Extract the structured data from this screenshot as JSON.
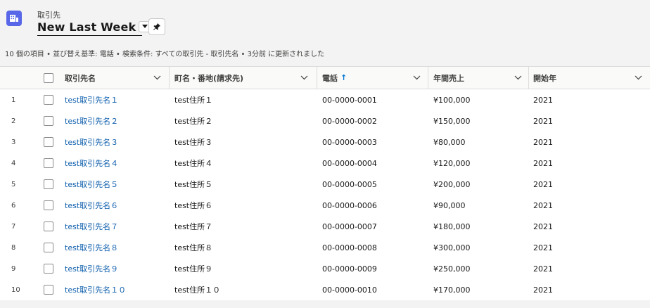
{
  "header": {
    "object_label": "取引先",
    "title": "New Last Week",
    "icon": "account-grid-icon",
    "dropdown_icon": "chevron-down-icon",
    "pin_icon": "pin-icon",
    "summary": "10 個の項目 • 並び替え基準: 電話 • 検索条件: すべての取引先 - 取引先名 • 3分前 に更新されました"
  },
  "columns": [
    {
      "key": "name",
      "label": "取引先名"
    },
    {
      "key": "address",
      "label": "町名・番地(請求先)"
    },
    {
      "key": "phone",
      "label": "電話",
      "sort": "↑"
    },
    {
      "key": "revenue",
      "label": "年間売上"
    },
    {
      "key": "year",
      "label": "開始年"
    }
  ],
  "rows": [
    {
      "num": "1",
      "name": "test取引先名１",
      "address": "test住所１",
      "phone": "00-0000-0001",
      "revenue": "¥100,000",
      "year": "2021"
    },
    {
      "num": "2",
      "name": "test取引先名２",
      "address": "test住所２",
      "phone": "00-0000-0002",
      "revenue": "¥150,000",
      "year": "2021"
    },
    {
      "num": "3",
      "name": "test取引先名３",
      "address": "test住所３",
      "phone": "00-0000-0003",
      "revenue": "¥80,000",
      "year": "2021"
    },
    {
      "num": "4",
      "name": "test取引先名４",
      "address": "test住所４",
      "phone": "00-0000-0004",
      "revenue": "¥120,000",
      "year": "2021"
    },
    {
      "num": "5",
      "name": "test取引先名５",
      "address": "test住所５",
      "phone": "00-0000-0005",
      "revenue": "¥200,000",
      "year": "2021"
    },
    {
      "num": "6",
      "name": "test取引先名６",
      "address": "test住所６",
      "phone": "00-0000-0006",
      "revenue": "¥90,000",
      "year": "2021"
    },
    {
      "num": "7",
      "name": "test取引先名７",
      "address": "test住所７",
      "phone": "00-0000-0007",
      "revenue": "¥180,000",
      "year": "2021"
    },
    {
      "num": "8",
      "name": "test取引先名８",
      "address": "test住所８",
      "phone": "00-0000-0008",
      "revenue": "¥300,000",
      "year": "2021"
    },
    {
      "num": "9",
      "name": "test取引先名９",
      "address": "test住所９",
      "phone": "00-0000-0009",
      "revenue": "¥250,000",
      "year": "2021"
    },
    {
      "num": "10",
      "name": "test取引先名１０",
      "address": "test住所１０",
      "phone": "00-0000-0010",
      "revenue": "¥170,000",
      "year": "2021"
    }
  ],
  "colors": {
    "accent_icon": "#5867e8",
    "link": "#0b5cab",
    "sort_arrow": "#0176d3"
  }
}
